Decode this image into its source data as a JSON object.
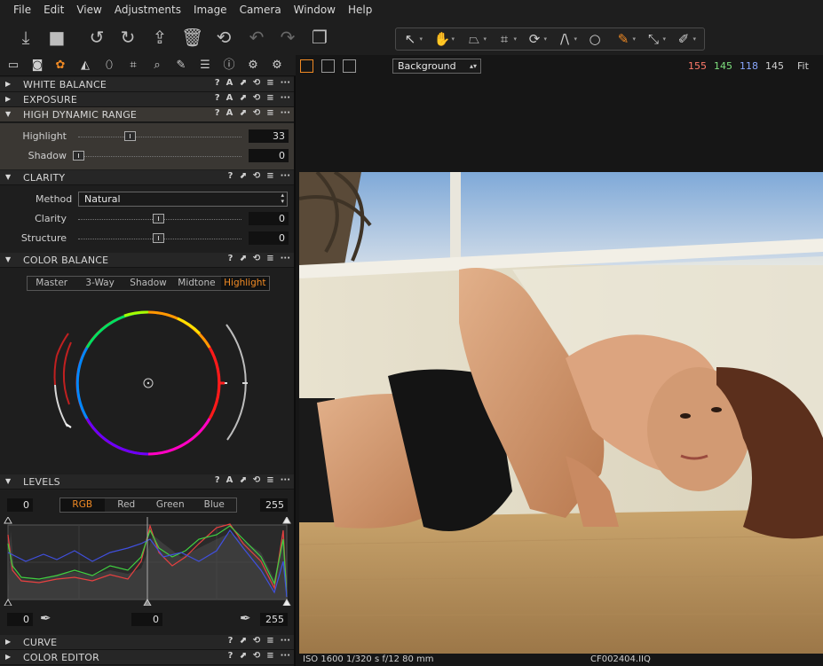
{
  "menu": [
    "File",
    "Edit",
    "View",
    "Adjustments",
    "Image",
    "Camera",
    "Window",
    "Help"
  ],
  "viewer_bar": {
    "background_label": "Background",
    "r": "155",
    "g": "145",
    "b": "118",
    "l": "145",
    "zoom": "Fit",
    "colors": {
      "r": "#ff7a6a",
      "g": "#7ee07e",
      "b": "#8aa8ff",
      "l": "#cfcfcf"
    }
  },
  "tools": {
    "white_balance": "WHITE BALANCE",
    "exposure": "EXPOSURE",
    "hdr": {
      "title": "HIGH DYNAMIC RANGE",
      "highlight_label": "Highlight",
      "highlight_value": "33",
      "shadow_label": "Shadow",
      "shadow_value": "0"
    },
    "clarity": {
      "title": "CLARITY",
      "method_label": "Method",
      "method_value": "Natural",
      "clarity_label": "Clarity",
      "clarity_value": "0",
      "structure_label": "Structure",
      "structure_value": "0"
    },
    "color_balance": {
      "title": "COLOR BALANCE",
      "tabs": [
        "Master",
        "3-Way",
        "Shadow",
        "Midtone",
        "Highlight"
      ],
      "active_tab": "Highlight"
    },
    "levels": {
      "title": "LEVELS",
      "tabs": [
        "RGB",
        "Red",
        "Green",
        "Blue"
      ],
      "active_tab": "RGB",
      "input_low": "0",
      "input_high": "255",
      "output_low": "0",
      "output_mid": "0",
      "output_high": "255"
    },
    "curve": "CURVE",
    "color_editor": "COLOR EDITOR"
  },
  "status": {
    "exif": "ISO 1600  1/320 s  f/12  80 mm",
    "filename": "CF002404.IIQ"
  },
  "icons": {
    "header_help": "?",
    "header_auto": "A"
  }
}
